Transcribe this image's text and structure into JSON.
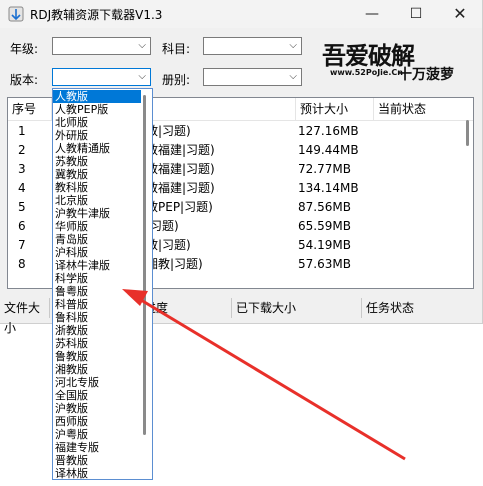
{
  "window": {
    "title": "RDJ教辅资源下载器V1.3"
  },
  "controls": {
    "grade_label": "年级:",
    "subject_label": "科目:",
    "edition_label": "版本:",
    "volume_label": "册别:"
  },
  "logo": {
    "main": "吾爱破解",
    "url": "www.52PoJie.Cn",
    "sub": "十万菠萝"
  },
  "table": {
    "columns": [
      "序号",
      "",
      "预计大小",
      "当前状态"
    ],
    "rows": [
      {
        "no": "1",
        "name": "教|习题)",
        "size": "127.16MB"
      },
      {
        "no": "2",
        "name": "教福建|习题)",
        "size": "149.44MB"
      },
      {
        "no": "3",
        "name": "教福建|习题)",
        "size": "72.77MB"
      },
      {
        "no": "4",
        "name": "教福建|习题)",
        "size": "134.14MB"
      },
      {
        "no": "5",
        "name": "教PEP|习题)",
        "size": "87.56MB"
      },
      {
        "no": "6",
        "name": "|习题)",
        "size": "65.59MB"
      },
      {
        "no": "7",
        "name": "教|习题)",
        "size": "54.19MB"
      },
      {
        "no": "8",
        "name": "湘教|习题)",
        "size": "57.63MB"
      }
    ]
  },
  "statusbar": {
    "file_size": "文件大小",
    "progress": "进度",
    "downloaded": "已下载大小",
    "task_status": "任务状态"
  },
  "dropdown": {
    "selected": "人教版",
    "items": [
      "人教版",
      "人教PEP版",
      "北师版",
      "外研版",
      "人教精通版",
      "苏教版",
      "冀教版",
      "教科版",
      "北京版",
      "沪教牛津版",
      "华师版",
      "青岛版",
      "沪科版",
      "译林牛津版",
      "科学版",
      "鲁粤版",
      "科普版",
      "鲁科版",
      "浙教版",
      "苏科版",
      "鲁教版",
      "湘教版",
      "河北专版",
      "全国版",
      "沪教版",
      "西师版",
      "沪粤版",
      "福建专版",
      "晋教版",
      "译林版"
    ]
  },
  "colors": {
    "accent": "#0078d7",
    "annotation_arrow": "#e8302a"
  }
}
